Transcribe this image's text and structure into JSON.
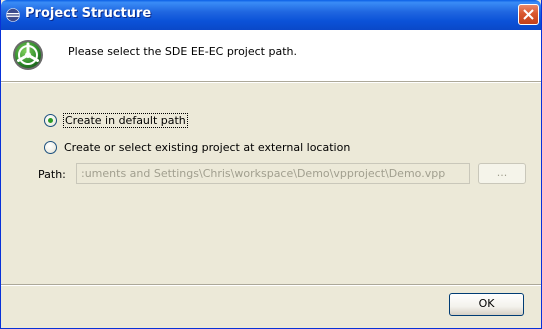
{
  "window": {
    "title": "Project Structure",
    "close_label": "Close"
  },
  "header": {
    "message": "Please select the SDE EE-EC project path."
  },
  "options": [
    {
      "label": "Create in default path",
      "checked": true
    },
    {
      "label": "Create or select existing project at external location",
      "checked": false
    }
  ],
  "path": {
    "label": "Path:",
    "value": ":uments and Settings\\Chris\\workspace\\Demo\\vpproject\\Demo.vpp",
    "browse_label": "..."
  },
  "footer": {
    "ok_label": "OK"
  },
  "colors": {
    "titlebar": "#0b52d8",
    "close": "#d9572e",
    "radio_dot": "#2b9a26",
    "dialog_bg": "#ece9d8"
  },
  "icons": {
    "title": "eclipse-icon",
    "logo": "sde-logo-icon"
  }
}
